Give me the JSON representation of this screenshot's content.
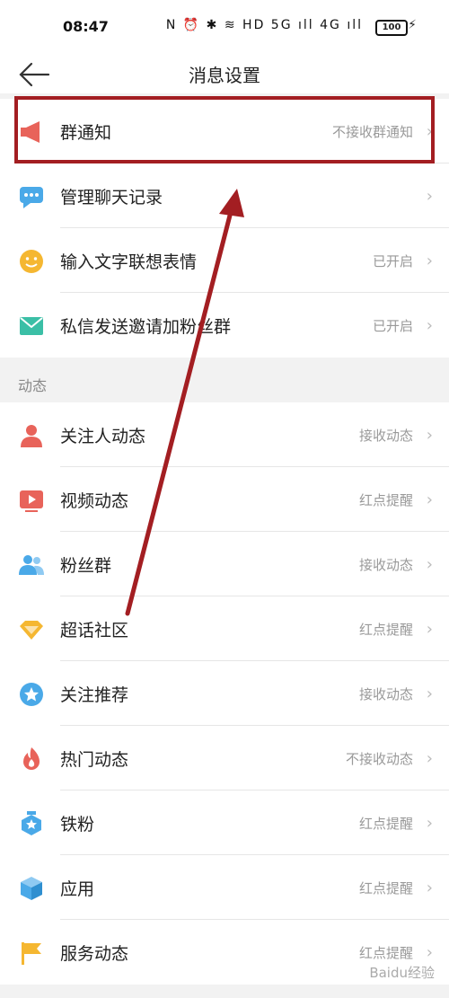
{
  "status": {
    "time": "08:47",
    "icons": "N ⏰ ✱ ≋ HD 5G ıll 4G ıll",
    "battery": "100"
  },
  "header": {
    "title": "消息设置"
  },
  "top_items": [
    {
      "label": "群通知",
      "value": "不接收群通知",
      "icon": "megaphone-icon",
      "color": "#e8635a"
    },
    {
      "label": "管理聊天记录",
      "value": "",
      "icon": "chat-bubble-icon",
      "color": "#4aa9e8"
    },
    {
      "label": "输入文字联想表情",
      "value": "已开启",
      "icon": "smiley-icon",
      "color": "#f5b731"
    },
    {
      "label": "私信发送邀请加粉丝群",
      "value": "已开启",
      "icon": "envelope-icon",
      "color": "#3bbfa6"
    }
  ],
  "section_title": "动态",
  "dyn_items": [
    {
      "label": "关注人动态",
      "value": "接收动态",
      "icon": "person-icon",
      "color": "#e8635a"
    },
    {
      "label": "视频动态",
      "value": "红点提醒",
      "icon": "video-icon",
      "color": "#e8635a"
    },
    {
      "label": "粉丝群",
      "value": "接收动态",
      "icon": "group-icon",
      "color": "#4aa9e8"
    },
    {
      "label": "超话社区",
      "value": "红点提醒",
      "icon": "diamond-icon",
      "color": "#f5b731"
    },
    {
      "label": "关注推荐",
      "value": "接收动态",
      "icon": "star-badge-icon",
      "color": "#4aa9e8"
    },
    {
      "label": "热门动态",
      "value": "不接收动态",
      "icon": "flame-icon",
      "color": "#e8635a"
    },
    {
      "label": "铁粉",
      "value": "红点提醒",
      "icon": "medal-icon",
      "color": "#4aa9e8"
    },
    {
      "label": "应用",
      "value": "红点提醒",
      "icon": "cube-icon",
      "color": "#4aa9e8"
    },
    {
      "label": "服务动态",
      "value": "红点提醒",
      "icon": "flag-icon",
      "color": "#f5b731"
    }
  ],
  "watermark": "Baidu经验"
}
